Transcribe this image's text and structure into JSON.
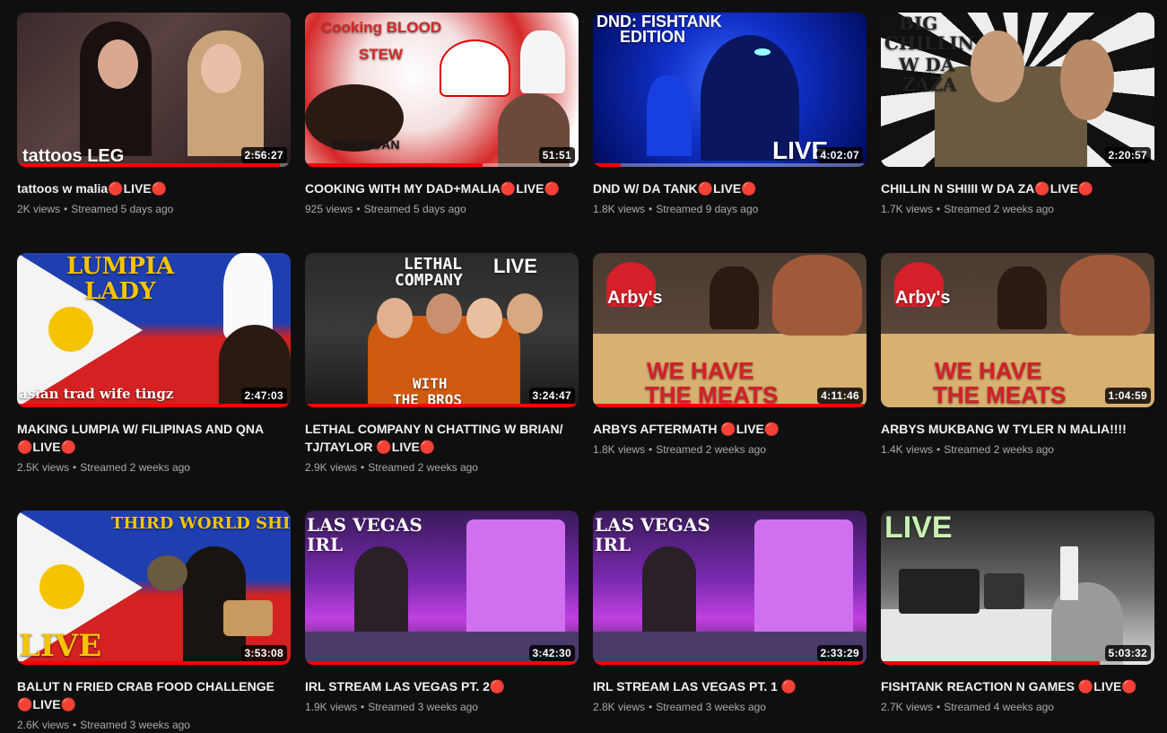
{
  "videos": [
    {
      "title": "tattoos w malia🔴LIVE🔴",
      "views": "2K views",
      "streamed": "Streamed 5 days ago",
      "duration": "2:56:27",
      "progress": 0.96,
      "thumb_text": [
        "tattoos LEG"
      ]
    },
    {
      "title": "COOKING WITH MY DAD+MALIA🔴LIVE🔴",
      "views": "925 views",
      "streamed": "Streamed 5 days ago",
      "duration": "51:51",
      "progress": 0.65,
      "thumb_text": [
        "Cooking BLOOD",
        "STEW",
        "DINUGUAN"
      ]
    },
    {
      "title": "DND W/ DA TANK🔴LIVE🔴",
      "views": "1.8K views",
      "streamed": "Streamed 9 days ago",
      "duration": "4:02:07",
      "progress": 0.1,
      "thumb_text": [
        "DND: FISHTANK",
        "EDITION",
        "LIVE"
      ]
    },
    {
      "title": "CHILLIN N SHIIII W DA ZA🔴LIVE🔴",
      "views": "1.7K views",
      "streamed": "Streamed 2 weeks ago",
      "duration": "2:20:57",
      "progress": 0,
      "thumb_text": [
        "BIG",
        "CHILLIN",
        "W DA",
        "ZAZA"
      ]
    },
    {
      "title": "MAKING LUMPIA W/ FILIPINAS AND QNA 🔴LIVE🔴",
      "views": "2.5K views",
      "streamed": "Streamed 2 weeks ago",
      "duration": "2:47:03",
      "progress": 0.99,
      "thumb_text": [
        "LUMPIA",
        "LADY",
        "asian trad wife tingz"
      ]
    },
    {
      "title": "LETHAL COMPANY N CHATTING W BRIAN/ TJ/TAYLOR 🔴LIVE🔴",
      "views": "2.9K views",
      "streamed": "Streamed 2 weeks ago",
      "duration": "3:24:47",
      "progress": 0.99,
      "thumb_text": [
        "LETHAL",
        "COMPANY",
        "LIVE",
        "WITH",
        "THE BROS"
      ]
    },
    {
      "title": "ARBYS AFTERMATH 🔴LIVE🔴",
      "views": "1.8K views",
      "streamed": "Streamed 2 weeks ago",
      "duration": "4:11:46",
      "progress": 0.99,
      "thumb_text": [
        "Arby's",
        "WE HAVE",
        "THE MEATS"
      ]
    },
    {
      "title": "ARBYS MUKBANG W TYLER N MALIA!!!!",
      "views": "1.4K views",
      "streamed": "Streamed 2 weeks ago",
      "duration": "1:04:59",
      "progress": 0,
      "thumb_text": [
        "Arby's",
        "WE HAVE",
        "THE MEATS"
      ]
    },
    {
      "title": "BALUT N FRIED CRAB FOOD CHALLENGE 🔴LIVE🔴",
      "views": "2.6K views",
      "streamed": "Streamed 3 weeks ago",
      "duration": "3:53:08",
      "progress": 0.99,
      "thumb_text": [
        "THIRD WORLD SHI",
        "LIVE"
      ]
    },
    {
      "title": "IRL STREAM LAS VEGAS PT. 2🔴",
      "views": "1.9K views",
      "streamed": "Streamed 3 weeks ago",
      "duration": "3:42:30",
      "progress": 0.99,
      "thumb_text": [
        "LAS VEGAS",
        "IRL"
      ]
    },
    {
      "title": "IRL STREAM LAS VEGAS PT. 1 🔴",
      "views": "2.8K views",
      "streamed": "Streamed 3 weeks ago",
      "duration": "2:33:29",
      "progress": 0.99,
      "thumb_text": [
        "LAS VEGAS",
        "IRL"
      ]
    },
    {
      "title": "FISHTANK REACTION N GAMES 🔴LIVE🔴",
      "views": "2.7K views",
      "streamed": "Streamed 4 weeks ago",
      "duration": "5:03:32",
      "progress": 0.8,
      "thumb_text": [
        "LIVE"
      ]
    }
  ],
  "colors": {
    "background": "#0f0f0f",
    "title": "#f1f1f1",
    "meta": "#aaaaaa",
    "progress": "#ff0000"
  }
}
